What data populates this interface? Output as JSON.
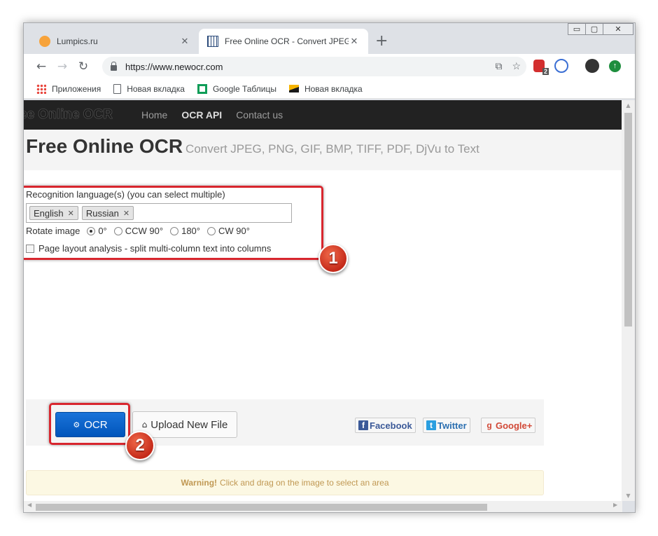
{
  "window": {
    "controls": {
      "minimize": "▭",
      "restore": "▢",
      "close": "✕"
    }
  },
  "tabs": [
    {
      "title": "Lumpics.ru",
      "close": "✕",
      "favicon": "orange-circle-icon"
    },
    {
      "title": "Free Online OCR - Convert JPEG",
      "close": "✕",
      "favicon": "grid-icon"
    }
  ],
  "new_tab": "+",
  "toolbar": {
    "back": "←",
    "forward": "→",
    "reload": "↻",
    "url": "https://www.newocr.com",
    "translate": "⧉",
    "star": "☆",
    "ext_badge": "2"
  },
  "bookmarks": [
    {
      "label": "Приложения",
      "icon": "apps-icon"
    },
    {
      "label": "Новая вкладка",
      "icon": "document-icon"
    },
    {
      "label": "Google Таблицы",
      "icon": "sheets-icon"
    },
    {
      "label": "Новая вкладка",
      "icon": "image-icon"
    }
  ],
  "site": {
    "brand": "ee Online OCR",
    "nav": [
      "Home",
      "OCR API",
      "Contact us"
    ],
    "title": "Free Online OCR",
    "subtitle": "Convert JPEG, PNG, GIF, BMP, TIFF, PDF, DjVu to Text"
  },
  "options": {
    "language_label": "Recognition language(s) (you can select multiple)",
    "languages": [
      "English",
      "Russian"
    ],
    "chip_remove": "✕",
    "rotate_label": "Rotate image",
    "rotate_options": [
      "0°",
      "CCW 90°",
      "180°",
      "CW 90°"
    ],
    "rotate_selected": "0°",
    "layout_label": "Page layout analysis - split multi-column text into columns"
  },
  "callouts": [
    "1",
    "2"
  ],
  "actions": {
    "ocr_label": "OCR",
    "ocr_icon": "⚙",
    "upload_label": "Upload New File",
    "upload_icon": "⌂"
  },
  "social": {
    "facebook": "Facebook",
    "facebook_icon": "f",
    "twitter": "Twitter",
    "twitter_icon": "t",
    "google": "Google+",
    "google_icon": "g"
  },
  "warning": {
    "strong": "Warning!",
    "text": "Click and drag on the image to select an area"
  },
  "colors": {
    "accent_blue": "#0055bb",
    "callout_red": "#d8262e",
    "navbar": "#222222",
    "facebook": "#3b5998",
    "twitter": "#2b9fe0",
    "google": "#d14836"
  }
}
